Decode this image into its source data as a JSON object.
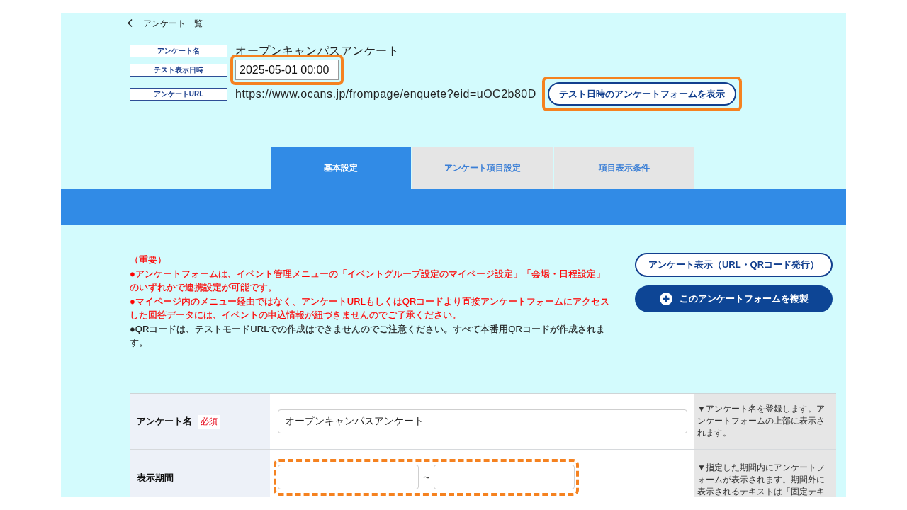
{
  "back_link": {
    "label": "アンケート一覧"
  },
  "header": {
    "fields": [
      {
        "kind": "text",
        "label": "アンケート名",
        "value": "オープンキャンパスアンケート",
        "highlighted": false
      },
      {
        "kind": "input",
        "label": "テスト表示日時",
        "value": "2025-05-01 00:00",
        "highlighted": true,
        "dashed": false
      },
      {
        "kind": "text",
        "label": "アンケートURL",
        "value": "https://www.ocans.jp/frompage/enquete?eid=uOC2b80D",
        "highlighted": false,
        "button": {
          "label": "テスト日時のアンケートフォームを表示",
          "highlighted": true,
          "dashed": false
        }
      }
    ]
  },
  "tabs": [
    {
      "label": "基本設定",
      "selected": true
    },
    {
      "label": "アンケート項目設定",
      "selected": false
    },
    {
      "label": "項目表示条件",
      "selected": false
    }
  ],
  "notice": {
    "lines": [
      {
        "text": "（重要）",
        "color": "#ff0000"
      },
      {
        "text": "●アンケートフォームは、イベント管理メニューの「イベントグループ設定のマイページ設定」「会場・日程設定」のいずれかで連携設定が可能です。",
        "color": "#ff0000"
      },
      {
        "text": "●マイページ内のメニュー経由ではなく、アンケートURLもしくはQRコードより直接アンケートフォームにアクセスした回答データには、イベントの申込情報が紐づきませんのでご了承ください。",
        "color": "#ff0000"
      },
      {
        "text": "●QRコードは、テストモードURLでの作成はできませんのでご注意ください。すべて本番用QRコードが作成されます。",
        "color": "#222222"
      }
    ]
  },
  "actions": [
    {
      "kind": "outline",
      "label": "アンケート表示（URL・QRコード発行）"
    },
    {
      "kind": "primary",
      "label": "このアンケートフォームを複製"
    }
  ],
  "form": {
    "rows": [
      {
        "kind": "text",
        "label": "アンケート名",
        "badge": "必須",
        "value": "オープンキャンパスアンケート",
        "description": "▼アンケート名を登録します。アンケートフォームの上部に表示されます。",
        "highlighted": false
      },
      {
        "kind": "range",
        "label": "表示期間",
        "separator": "～",
        "description": "▼指定した期間内にアンケートフォームが表示されます。期間外に表示されるテキストは「固定テキ",
        "highlighted": true,
        "dashed": true
      }
    ]
  }
}
